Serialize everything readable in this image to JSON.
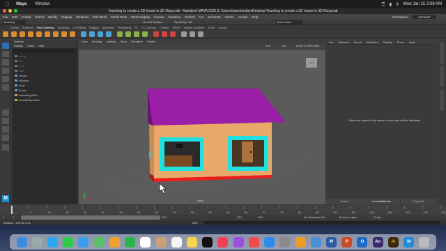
{
  "mac_menu": {
    "app": "Maya",
    "window": "Window",
    "clock": "Wed Jan 15  3:08 AM"
  },
  "window_title": "Teaching to create a 3D house in 3D Maya.mb - Autodesk MAYA 2025.3: /Users/newchristian/Desktop/Teaching to create a 3D house in 3D Maya.mb",
  "maya_menu": [
    "File",
    "Edit",
    "Create",
    "Select",
    "Modify",
    "Display",
    "Windows",
    "Edit Mesh",
    "Mesh Tools",
    "Mesh Display",
    "Curves",
    "Surfaces",
    "Deform",
    "UV",
    "Generate",
    "Cache",
    "Arnold",
    "Help"
  ],
  "workspace": {
    "label": "Workspace:",
    "value": "General*"
  },
  "mode_dropdown": "Modeling",
  "live_surface": "No Live Surface",
  "symmetry": "Symmetry: Off",
  "sign_in": "Book author",
  "shelf_tabs": [
    "Curves",
    "Surfaces",
    "Poly Modeling",
    "Sculpting",
    "UV Editing",
    "Rigging",
    "Animation",
    "Rendering",
    "FX",
    "FX Caching",
    "Custom",
    "MASH",
    "Motion Graphics",
    "XGen",
    "Arnold"
  ],
  "outliner": {
    "title": "Outliner",
    "menu": [
      "Display",
      "Show",
      "Help"
    ],
    "items": [
      {
        "label": "persp",
        "dim": true
      },
      {
        "label": "top",
        "dim": true
      },
      {
        "label": "front",
        "dim": true
      },
      {
        "label": "side",
        "dim": true
      },
      {
        "label": "House",
        "dim": false
      },
      {
        "label": "Window",
        "dim": false
      },
      {
        "label": "Roof",
        "dim": false
      },
      {
        "label": "Doors",
        "dim": false
      },
      {
        "label": "defaultLightSet",
        "dim": false
      },
      {
        "label": "defaultObjectSet",
        "dim": false
      }
    ]
  },
  "viewport": {
    "menu": [
      "View",
      "Shading",
      "Lighting",
      "Show",
      "Renderer",
      "Panels"
    ],
    "camera_label": "persp",
    "viewcube_label": "LEFT",
    "fields": [
      "0.00",
      "1.00"
    ],
    "color_space": "ACES 1.0 SDR-video"
  },
  "attribute_editor": {
    "menu": [
      "List",
      "Selected",
      "Focus",
      "Attributes",
      "Display",
      "Show",
      "Help"
    ],
    "message": "Select an object in the scene to view and edit its attributes",
    "buttons": [
      "Select",
      "Load Attributes",
      "Copy Tab"
    ]
  },
  "time_slider": {
    "ticks": [
      "1",
      "5",
      "10",
      "15",
      "20",
      "25",
      "30",
      "35",
      "40",
      "45",
      "50",
      "55",
      "60",
      "65",
      "70",
      "75",
      "80",
      "85",
      "90",
      "95",
      "100",
      "105",
      "110",
      "115",
      "120"
    ],
    "current_frame": "1"
  },
  "range_slider": {
    "start": "1",
    "start2": "1",
    "end": "120",
    "end2": "120",
    "end3": "200",
    "character_set": "No Character Set",
    "anim_layer": "No Anim Layer",
    "fps": "24 fps"
  },
  "command_line": {
    "lang": "MEL",
    "status": "Rotation: -132.56  3.46"
  },
  "dock_apps": [
    "Finder",
    "Launchpad",
    "Safari",
    "Messages",
    "Mail",
    "Maps",
    "Photos",
    "FaceTime",
    "Calendar",
    "Contacts",
    "Reminders",
    "Notes",
    "TV",
    "Music",
    "Podcasts",
    "News",
    "App Store",
    "System Settings",
    "Pages",
    "Preview",
    "Word",
    "PowerPoint",
    "Outlook",
    "Animate",
    "Illustrator",
    "Maya",
    "Trash"
  ],
  "colors": {
    "roof": "#9b1ea8",
    "wall": "#e8a96a",
    "frame": "#21e0e0",
    "base": "#f01c1c",
    "maya_blue": "#1e8fd6"
  }
}
